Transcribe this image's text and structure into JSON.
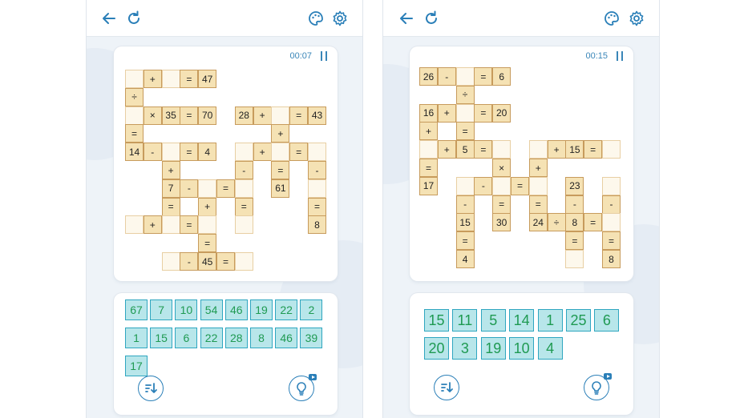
{
  "colors": {
    "accent": "#2a7fb8",
    "tile_bg": "#b8e6ea",
    "tile_border": "#2fa6c0",
    "tile_text": "#1f9a52",
    "cell_filled": "#f5e2b4",
    "cell_blank": "#fdf8ec"
  },
  "icons": {
    "back": "arrow-left-icon",
    "restart": "refresh-icon",
    "theme": "palette-icon",
    "settings": "gear-icon",
    "pause": "pause-icon",
    "sort": "sort-icon",
    "hint": "lightbulb-icon"
  },
  "screens": [
    {
      "timer": "00:07",
      "cells": [
        {
          "c": 0,
          "r": 0,
          "t": "",
          "f": false
        },
        {
          "c": 1,
          "r": 0,
          "t": "+",
          "f": true
        },
        {
          "c": 2,
          "r": 0,
          "t": "",
          "f": false
        },
        {
          "c": 3,
          "r": 0,
          "t": "=",
          "f": true
        },
        {
          "c": 4,
          "r": 0,
          "t": "47",
          "f": true
        },
        {
          "c": 0,
          "r": 1,
          "t": "÷",
          "f": true
        },
        {
          "c": 0,
          "r": 2,
          "t": "",
          "f": false
        },
        {
          "c": 1,
          "r": 2,
          "t": "×",
          "f": true
        },
        {
          "c": 2,
          "r": 2,
          "t": "35",
          "f": true
        },
        {
          "c": 3,
          "r": 2,
          "t": "=",
          "f": true
        },
        {
          "c": 4,
          "r": 2,
          "t": "70",
          "f": true
        },
        {
          "c": 6,
          "r": 2,
          "t": "28",
          "f": true
        },
        {
          "c": 7,
          "r": 2,
          "t": "+",
          "f": true
        },
        {
          "c": 8,
          "r": 2,
          "t": "",
          "f": false
        },
        {
          "c": 9,
          "r": 2,
          "t": "=",
          "f": true
        },
        {
          "c": 10,
          "r": 2,
          "t": "43",
          "f": true
        },
        {
          "c": 0,
          "r": 3,
          "t": "=",
          "f": true
        },
        {
          "c": 8,
          "r": 3,
          "t": "+",
          "f": true
        },
        {
          "c": 0,
          "r": 4,
          "t": "14",
          "f": true
        },
        {
          "c": 1,
          "r": 4,
          "t": "-",
          "f": true
        },
        {
          "c": 2,
          "r": 4,
          "t": "",
          "f": false
        },
        {
          "c": 3,
          "r": 4,
          "t": "=",
          "f": true
        },
        {
          "c": 4,
          "r": 4,
          "t": "4",
          "f": true
        },
        {
          "c": 6,
          "r": 4,
          "t": "",
          "f": false
        },
        {
          "c": 7,
          "r": 4,
          "t": "+",
          "f": true
        },
        {
          "c": 8,
          "r": 4,
          "t": "",
          "f": false
        },
        {
          "c": 9,
          "r": 4,
          "t": "=",
          "f": true
        },
        {
          "c": 10,
          "r": 4,
          "t": "",
          "f": false
        },
        {
          "c": 2,
          "r": 5,
          "t": "+",
          "f": true
        },
        {
          "c": 6,
          "r": 5,
          "t": "-",
          "f": true
        },
        {
          "c": 8,
          "r": 5,
          "t": "=",
          "f": true
        },
        {
          "c": 10,
          "r": 5,
          "t": "-",
          "f": true
        },
        {
          "c": 2,
          "r": 6,
          "t": "7",
          "f": true
        },
        {
          "c": 3,
          "r": 6,
          "t": "-",
          "f": true
        },
        {
          "c": 4,
          "r": 6,
          "t": "",
          "f": false
        },
        {
          "c": 5,
          "r": 6,
          "t": "=",
          "f": true
        },
        {
          "c": 6,
          "r": 6,
          "t": "",
          "f": false
        },
        {
          "c": 8,
          "r": 6,
          "t": "61",
          "f": true
        },
        {
          "c": 10,
          "r": 6,
          "t": "",
          "f": false
        },
        {
          "c": 2,
          "r": 7,
          "t": "=",
          "f": true
        },
        {
          "c": 4,
          "r": 7,
          "t": "+",
          "f": true
        },
        {
          "c": 6,
          "r": 7,
          "t": "=",
          "f": true
        },
        {
          "c": 10,
          "r": 7,
          "t": "=",
          "f": true
        },
        {
          "c": 0,
          "r": 8,
          "t": "",
          "f": false
        },
        {
          "c": 1,
          "r": 8,
          "t": "+",
          "f": true
        },
        {
          "c": 2,
          "r": 8,
          "t": "",
          "f": false
        },
        {
          "c": 3,
          "r": 8,
          "t": "=",
          "f": true
        },
        {
          "c": 4,
          "r": 8,
          "t": "",
          "f": false
        },
        {
          "c": 6,
          "r": 8,
          "t": "",
          "f": false
        },
        {
          "c": 10,
          "r": 8,
          "t": "8",
          "f": true
        },
        {
          "c": 4,
          "r": 9,
          "t": "=",
          "f": true
        },
        {
          "c": 2,
          "r": 10,
          "t": "",
          "f": false
        },
        {
          "c": 3,
          "r": 10,
          "t": "-",
          "f": true
        },
        {
          "c": 4,
          "r": 10,
          "t": "45",
          "f": true
        },
        {
          "c": 5,
          "r": 10,
          "t": "=",
          "f": true
        },
        {
          "c": 6,
          "r": 10,
          "t": "",
          "f": false
        }
      ],
      "tile_rows": [
        [
          "67",
          "7",
          "10",
          "54",
          "46",
          "19",
          "22",
          "2"
        ],
        [
          "1",
          "15",
          "6",
          "22",
          "28",
          "8",
          "46",
          "39"
        ],
        [
          "17"
        ]
      ]
    },
    {
      "timer": "00:15",
      "cells": [
        {
          "c": 0,
          "r": 0,
          "t": "26",
          "f": true
        },
        {
          "c": 1,
          "r": 0,
          "t": "-",
          "f": true
        },
        {
          "c": 2,
          "r": 0,
          "t": "",
          "f": false
        },
        {
          "c": 3,
          "r": 0,
          "t": "=",
          "f": true
        },
        {
          "c": 4,
          "r": 0,
          "t": "6",
          "f": true
        },
        {
          "c": 2,
          "r": 1,
          "t": "÷",
          "f": true
        },
        {
          "c": 0,
          "r": 2,
          "t": "16",
          "f": true
        },
        {
          "c": 1,
          "r": 2,
          "t": "+",
          "f": true
        },
        {
          "c": 2,
          "r": 2,
          "t": "",
          "f": false
        },
        {
          "c": 3,
          "r": 2,
          "t": "=",
          "f": true
        },
        {
          "c": 4,
          "r": 2,
          "t": "20",
          "f": true
        },
        {
          "c": 0,
          "r": 3,
          "t": "+",
          "f": true
        },
        {
          "c": 2,
          "r": 3,
          "t": "=",
          "f": true
        },
        {
          "c": 0,
          "r": 4,
          "t": "",
          "f": false
        },
        {
          "c": 1,
          "r": 4,
          "t": "+",
          "f": true
        },
        {
          "c": 2,
          "r": 4,
          "t": "5",
          "f": true
        },
        {
          "c": 3,
          "r": 4,
          "t": "=",
          "f": true
        },
        {
          "c": 4,
          "r": 4,
          "t": "",
          "f": false
        },
        {
          "c": 6,
          "r": 4,
          "t": "",
          "f": false
        },
        {
          "c": 7,
          "r": 4,
          "t": "+",
          "f": true
        },
        {
          "c": 8,
          "r": 4,
          "t": "15",
          "f": true
        },
        {
          "c": 9,
          "r": 4,
          "t": "=",
          "f": true
        },
        {
          "c": 10,
          "r": 4,
          "t": "",
          "f": false
        },
        {
          "c": 0,
          "r": 5,
          "t": "=",
          "f": true
        },
        {
          "c": 4,
          "r": 5,
          "t": "×",
          "f": true
        },
        {
          "c": 6,
          "r": 5,
          "t": "+",
          "f": true
        },
        {
          "c": 0,
          "r": 6,
          "t": "17",
          "f": true
        },
        {
          "c": 2,
          "r": 6,
          "t": "",
          "f": false
        },
        {
          "c": 3,
          "r": 6,
          "t": "-",
          "f": true
        },
        {
          "c": 4,
          "r": 6,
          "t": "",
          "f": false
        },
        {
          "c": 5,
          "r": 6,
          "t": "=",
          "f": true
        },
        {
          "c": 6,
          "r": 6,
          "t": "",
          "f": false
        },
        {
          "c": 8,
          "r": 6,
          "t": "23",
          "f": true
        },
        {
          "c": 10,
          "r": 6,
          "t": "",
          "f": false
        },
        {
          "c": 2,
          "r": 7,
          "t": "-",
          "f": true
        },
        {
          "c": 4,
          "r": 7,
          "t": "=",
          "f": true
        },
        {
          "c": 6,
          "r": 7,
          "t": "=",
          "f": true
        },
        {
          "c": 8,
          "r": 7,
          "t": "-",
          "f": true
        },
        {
          "c": 10,
          "r": 7,
          "t": "-",
          "f": true
        },
        {
          "c": 2,
          "r": 8,
          "t": "15",
          "f": true
        },
        {
          "c": 4,
          "r": 8,
          "t": "30",
          "f": true
        },
        {
          "c": 6,
          "r": 8,
          "t": "24",
          "f": true
        },
        {
          "c": 7,
          "r": 8,
          "t": "÷",
          "f": true
        },
        {
          "c": 8,
          "r": 8,
          "t": "8",
          "f": true
        },
        {
          "c": 9,
          "r": 8,
          "t": "=",
          "f": true
        },
        {
          "c": 10,
          "r": 8,
          "t": "",
          "f": false
        },
        {
          "c": 2,
          "r": 9,
          "t": "=",
          "f": true
        },
        {
          "c": 8,
          "r": 9,
          "t": "=",
          "f": true
        },
        {
          "c": 10,
          "r": 9,
          "t": "=",
          "f": true
        },
        {
          "c": 2,
          "r": 10,
          "t": "4",
          "f": true
        },
        {
          "c": 8,
          "r": 10,
          "t": "",
          "f": false
        },
        {
          "c": 10,
          "r": 10,
          "t": "8",
          "f": true
        }
      ],
      "tile_rows": [
        [
          "15",
          "11",
          "5",
          "14",
          "1",
          "25",
          "6"
        ],
        [
          "20",
          "3",
          "19",
          "10",
          "4"
        ]
      ]
    }
  ]
}
